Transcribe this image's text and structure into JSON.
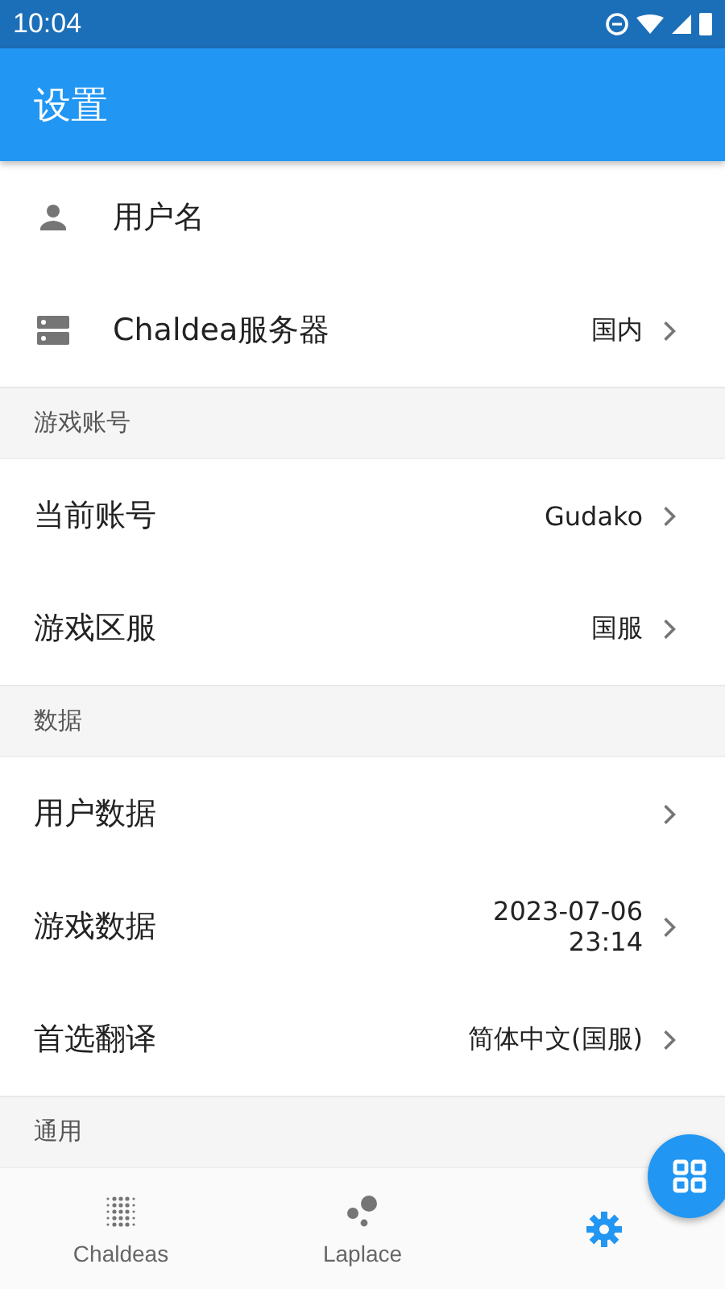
{
  "status_bar": {
    "time": "10:04"
  },
  "app_bar": {
    "title": "设置"
  },
  "sections": [
    {
      "items": [
        {
          "label": "用户名",
          "chevron": false
        },
        {
          "label": "Chaldea服务器",
          "value": [
            "国内"
          ],
          "chevron": true
        }
      ]
    },
    {
      "header": "游戏账号",
      "items": [
        {
          "label": "当前账号",
          "value": [
            "Gudako"
          ],
          "chevron": true
        },
        {
          "label": "游戏区服",
          "value": [
            "国服"
          ],
          "chevron": true
        }
      ]
    },
    {
      "header": "数据",
      "items": [
        {
          "label": "用户数据",
          "chevron": true
        },
        {
          "label": "游戏数据",
          "value": [
            "2023-07-06",
            "23:14"
          ],
          "chevron": true
        },
        {
          "label": "首选翻译",
          "value": [
            "简体中文(国服)"
          ],
          "chevron": true
        }
      ]
    },
    {
      "header": "通用"
    }
  ],
  "bottom_nav": [
    {
      "label": "Chaldeas",
      "selected": false
    },
    {
      "label": "Laplace",
      "selected": false
    },
    {
      "selected": true
    }
  ]
}
